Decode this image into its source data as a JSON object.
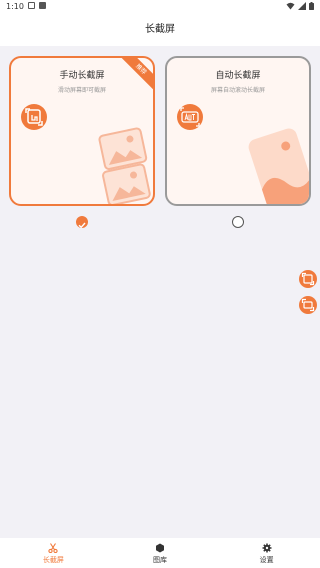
{
  "status_bar": {
    "time": "1:10",
    "icons": [
      "image-notification-icon",
      "download-notification-icon",
      "wifi-icon",
      "signal-icon",
      "battery-icon"
    ]
  },
  "header": {
    "title": "长截屏"
  },
  "modes": [
    {
      "title": "手动长截屏",
      "subtitle": "滑动屏幕即可截屏",
      "badge": "推荐",
      "icon": "manual-scroll-capture-icon",
      "selected": true
    },
    {
      "title": "自动长截屏",
      "subtitle": "屏幕自动滚动长截屏",
      "icon": "auto-capture-icon",
      "selected": false
    }
  ],
  "floating_buttons": [
    "floating-capture-icon",
    "floating-capture-alt-icon"
  ],
  "bottom_nav": [
    {
      "label": "长截屏",
      "icon": "scissors-icon",
      "active": true
    },
    {
      "label": "图库",
      "icon": "gallery-icon",
      "active": false
    },
    {
      "label": "设置",
      "icon": "gear-icon",
      "active": false
    }
  ],
  "colors": {
    "accent": "#f07a3c",
    "card_bg": "#fff6f2",
    "page_bg": "#f2f1f6"
  }
}
